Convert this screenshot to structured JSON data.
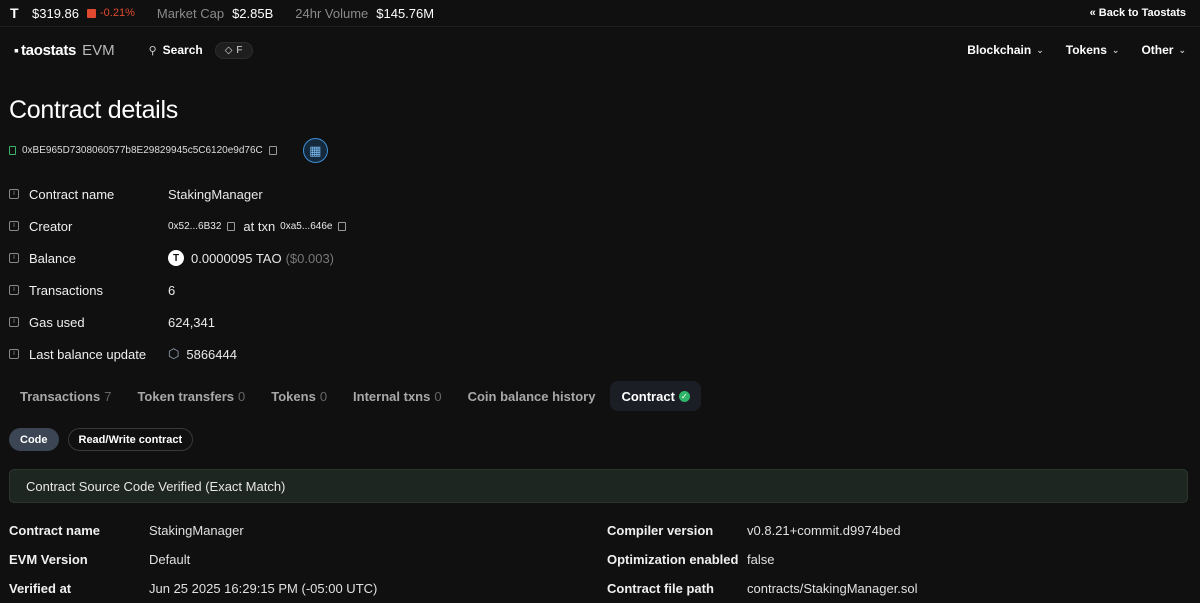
{
  "topbar": {
    "token_symbol": "T",
    "price": "$319.86",
    "change": "-0.21%",
    "market_cap_label": "Market Cap",
    "market_cap_value": "$2.85B",
    "volume_label": "24hr Volume",
    "volume_value": "$145.76M",
    "back_link": "« Back to Taostats"
  },
  "navbar": {
    "brand_mark": "▪",
    "brand_name": "taostats",
    "brand_suffix": "EVM",
    "search_label": "Search",
    "shortcut_key": "F",
    "menu": [
      {
        "label": "Blockchain"
      },
      {
        "label": "Tokens"
      },
      {
        "label": "Other"
      }
    ]
  },
  "page": {
    "title": "Contract details",
    "address": "0xBE965D7308060577b8E29829945c5C6120e9d76C"
  },
  "details": {
    "contract_name": {
      "label": "Contract name",
      "value": "StakingManager"
    },
    "creator": {
      "label": "Creator",
      "address": "0x52...6B32",
      "at_txn": "at txn",
      "txn": "0xa5...646e"
    },
    "balance": {
      "label": "Balance",
      "coin": "T",
      "value": "0.0000095 TAO",
      "usd": "($0.003)"
    },
    "transactions": {
      "label": "Transactions",
      "value": "6"
    },
    "gas_used": {
      "label": "Gas used",
      "value": "624,341"
    },
    "last_balance_update": {
      "label": "Last balance update",
      "value": "5866444"
    }
  },
  "tabs": [
    {
      "label": "Transactions",
      "count": "7"
    },
    {
      "label": "Token transfers",
      "count": "0"
    },
    {
      "label": "Tokens",
      "count": "0"
    },
    {
      "label": "Internal txns",
      "count": "0"
    },
    {
      "label": "Coin balance history",
      "count": ""
    },
    {
      "label": "Contract",
      "count": ""
    }
  ],
  "subtabs": {
    "code": "Code",
    "read_write": "Read/Write contract"
  },
  "verified_message": "Contract Source Code Verified (Exact Match)",
  "meta_left": [
    {
      "label": "Contract name",
      "value": "StakingManager"
    },
    {
      "label": "EVM Version",
      "value": "Default"
    },
    {
      "label": "Verified at",
      "value": "Jun 25 2025 16:29:15 PM (-05:00 UTC)"
    }
  ],
  "meta_right": [
    {
      "label": "Compiler version",
      "value": "v0.8.21+commit.d9974bed"
    },
    {
      "label": "Optimization enabled",
      "value": "false"
    },
    {
      "label": "Contract file path",
      "value": "contracts/StakingManager.sol"
    }
  ],
  "colors": {
    "accent_green": "#2fb46a",
    "negative_red": "#e0492f",
    "qr_blue": "#3e8ed6"
  }
}
